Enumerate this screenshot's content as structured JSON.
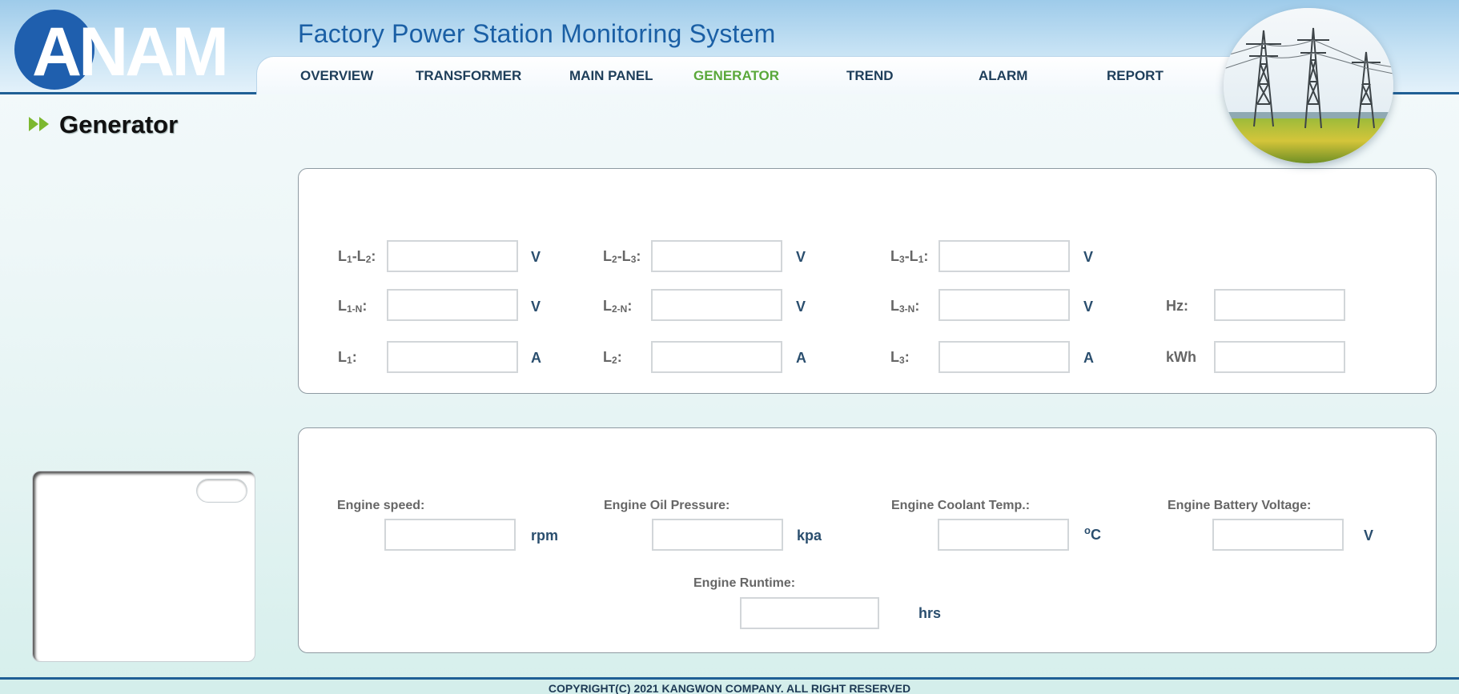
{
  "header": {
    "logo_text": "ANAM",
    "app_title": "Factory Power Station Monitoring System"
  },
  "nav": {
    "items": [
      {
        "label": "OVERVIEW"
      },
      {
        "label": "TRANSFORMER"
      },
      {
        "label": "MAIN PANEL"
      },
      {
        "label": "GENERATOR",
        "active": true
      },
      {
        "label": "TREND"
      },
      {
        "label": "ALARM"
      },
      {
        "label": "REPORT"
      }
    ]
  },
  "page": {
    "title": "Generator"
  },
  "electrical": {
    "l1_l2": {
      "value": "",
      "unit": "V"
    },
    "l2_l3": {
      "value": "",
      "unit": "V"
    },
    "l3_l1": {
      "value": "",
      "unit": "V"
    },
    "l1_n": {
      "value": "",
      "unit": "V"
    },
    "l2_n": {
      "value": "",
      "unit": "V"
    },
    "l3_n": {
      "value": "",
      "unit": "V"
    },
    "hz": {
      "label": "Hz:",
      "value": ""
    },
    "l1": {
      "value": "",
      "unit": "A"
    },
    "l2": {
      "value": "",
      "unit": "A"
    },
    "l3": {
      "value": "",
      "unit": "A"
    },
    "kwh": {
      "label": "kWh",
      "value": ""
    }
  },
  "engine": {
    "speed": {
      "label": "Engine speed:",
      "value": "",
      "unit": "rpm"
    },
    "oil_pressure": {
      "label": "Engine Oil Pressure:",
      "value": "",
      "unit": "kpa"
    },
    "coolant_temp": {
      "label": "Engine Coolant Temp.:",
      "value": "",
      "unit_sup": "o",
      "unit": "C"
    },
    "battery_voltage": {
      "label": "Engine Battery Voltage:",
      "value": "",
      "unit": "V"
    },
    "runtime": {
      "label": "Engine Runtime:",
      "value": "",
      "unit": "hrs"
    }
  },
  "footer": {
    "copyright": "COPYRIGHT(C) 2021 KANGWON COMPANY. ALL RIGHT RESERVED"
  },
  "colors": {
    "accent": "#1a5fa5",
    "nav_active": "#5aa83a",
    "nav_text": "#1e3e5a",
    "header_border": "#1f5f95"
  }
}
